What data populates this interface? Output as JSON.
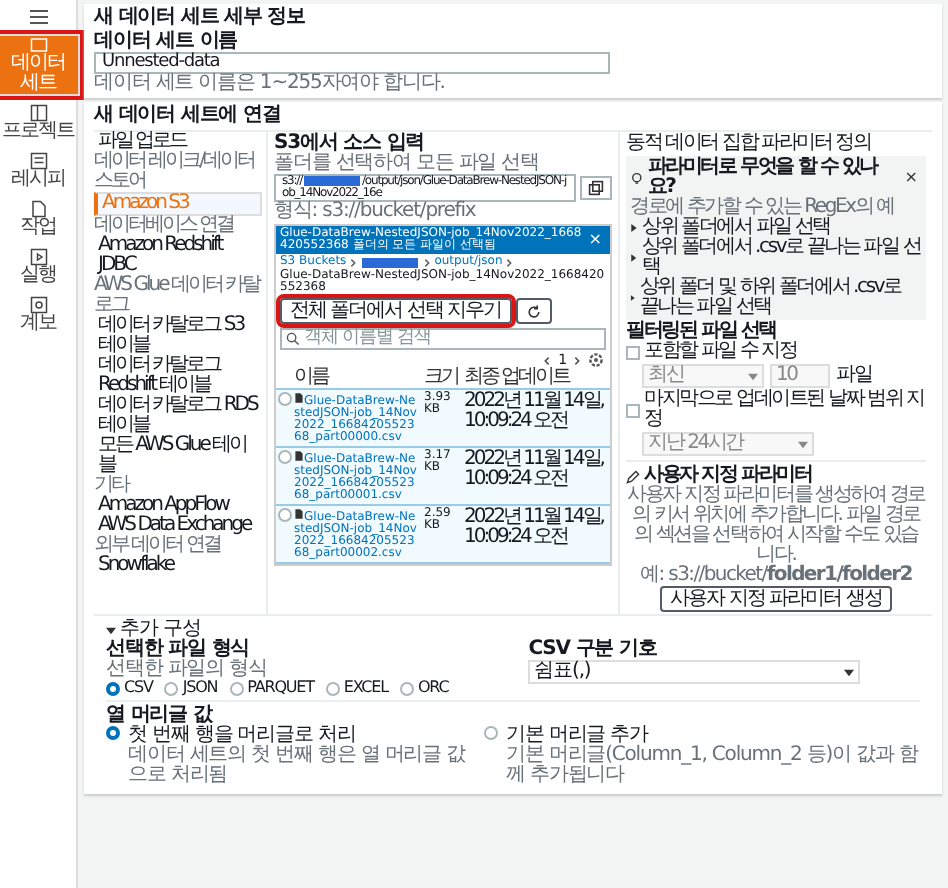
{
  "rail": {
    "items": [
      {
        "label": "데이터 세트",
        "selected": true,
        "highlighted": true
      },
      {
        "label": "프로젝트",
        "selected": false,
        "highlighted": false
      },
      {
        "label": "레시피",
        "selected": false,
        "highlighted": false
      },
      {
        "label": "작업",
        "selected": false,
        "highlighted": false
      },
      {
        "label": "실행",
        "selected": false,
        "highlighted": false
      },
      {
        "label": "계보",
        "selected": false,
        "highlighted": false
      }
    ]
  },
  "details": {
    "title": "새 데이터 세트 세부 정보",
    "name_label": "데이터 세트 이름",
    "name_value": "Unnested-data",
    "hint": "데이터 세트 이름은 1~255자여야 합니다."
  },
  "connect": {
    "title": "새 데이터 세트에 연결",
    "sources": [
      {
        "kind": "item",
        "label": "파일 업로드",
        "selected": false
      },
      {
        "kind": "group",
        "label": "데이터 레이크/데이터 스토어"
      },
      {
        "kind": "item",
        "label": "Amazon S3",
        "selected": true
      },
      {
        "kind": "group",
        "label": "데이터베이스 연결"
      },
      {
        "kind": "item",
        "label": "Amazon Redshift",
        "selected": false
      },
      {
        "kind": "item",
        "label": "JDBC",
        "selected": false
      },
      {
        "kind": "group",
        "label": "AWS Glue 데이터 카탈로그"
      },
      {
        "kind": "item",
        "label": "데이터 카탈로그 S3 테이블",
        "selected": false
      },
      {
        "kind": "item",
        "label": "데이터 카탈로그 Redshift 테이블",
        "selected": false
      },
      {
        "kind": "item",
        "label": "데이터 카탈로그 RDS 테이블",
        "selected": false
      },
      {
        "kind": "item",
        "label": "모든 AWS Glue 테이블",
        "selected": false
      },
      {
        "kind": "group",
        "label": "기타"
      },
      {
        "kind": "item",
        "label": "Amazon AppFlow",
        "selected": false
      },
      {
        "kind": "item",
        "label": "AWS Data Exchange",
        "selected": false
      },
      {
        "kind": "group",
        "label": "외부 데이터 연결"
      },
      {
        "kind": "item",
        "label": "Snowflake",
        "selected": false
      }
    ],
    "s3": {
      "title": "S3에서 소스 입력",
      "description": "폴더를 선택하여 모든 파일 선택",
      "path_prefix": "s3://",
      "path_suffix": "/output/json/Glue-DataBrew-NestedJSON-job_14Nov2022_16e",
      "format_hint": "형식: s3://bucket/prefix",
      "browser": {
        "header": "Glue-DataBrew-NestedJSON-job_14Nov2022_1668420552368 폴더의 모든 파일이 선택됨",
        "close": "×",
        "breadcrumb": [
          {
            "kind": "link",
            "text": "S3 Buckets"
          },
          {
            "kind": "redacted"
          },
          {
            "kind": "link",
            "text": "output/json"
          },
          {
            "kind": "text",
            "text": "Glue-DataBrew-NestedJSON-job_14Nov2022_1668420552368"
          }
        ],
        "clear_button": {
          "label": "전체 폴더에서 선택 지우기",
          "highlighted": true
        },
        "search_placeholder": "객체 이름별 검색",
        "page": "1",
        "columns": [
          "이름",
          "크기",
          "최종 업데이트"
        ],
        "rows": [
          {
            "name": "Glue-DataBrew-NestedJSON-job_14Nov2022_1668420552368_part00000.csv",
            "size": "3.93 KB",
            "updated": "2022년 11월 14일, 10:09:24 오전",
            "selected": false
          },
          {
            "name": "Glue-DataBrew-NestedJSON-job_14Nov2022_1668420552368_part00001.csv",
            "size": "3.17 KB",
            "updated": "2022년 11월 14일, 10:09:24 오전",
            "selected": false
          },
          {
            "name": "Glue-DataBrew-NestedJSON-job_14Nov2022_1668420552368_part00002.csv",
            "size": "2.59 KB",
            "updated": "2022년 11월 14일, 10:09:24 오전",
            "selected": false
          }
        ]
      }
    },
    "params": {
      "title": "동적 데이터 집합 파라미터 정의",
      "info": {
        "title": "파라미터로 무엇을 할 수 있나요?",
        "subtitle": "경로에 추가할 수 있는 RegEx의 예",
        "close": "×",
        "items": [
          "상위 폴더에서 파일 선택",
          "상위 폴더에서 .csv로 끝나는 파일 선택",
          "상위 폴더 및 하위 폴더에서 .csv로 끝나는 파일 선택"
        ]
      },
      "filter_title": "필터링된 파일 선택",
      "file_count": {
        "label": "포함할 파일 수 지정",
        "checked": false,
        "order": "최신",
        "count": "10",
        "unit": "파일"
      },
      "date_range": {
        "label": "마지막으로 업데이트된 날짜 범위 지정",
        "checked": false,
        "value": "지난 24시간"
      },
      "custom_title": "사용자 지정 파라미터",
      "custom_text": "사용자 지정 파라미터를 생성하여 경로의 키서 위치에 추가합니다. 파일 경로의 섹션을 선택하여 시작할 수도 있습니다.",
      "example": "예: s3://bucket/**folder1/folder2**",
      "custom_button": "사용자 지정 파라미터 생성"
    }
  },
  "additional": {
    "toggle": "추가 구성",
    "expanded": true,
    "format_label": "선택한 파일 형식",
    "format_hint": "선택한 파일의 형식",
    "formats": [
      {
        "label": "CSV",
        "selected": true
      },
      {
        "label": "JSON",
        "selected": false
      },
      {
        "label": "PARQUET",
        "selected": false
      },
      {
        "label": "EXCEL",
        "selected": false
      },
      {
        "label": "ORC",
        "selected": false
      }
    ],
    "delimiter_label": "CSV 구분 기호",
    "delimiter_value": "쉼표(,)",
    "header_label": "열 머리글 값",
    "header_options": [
      {
        "label": "첫 번째 행을 머리글로 처리",
        "description": "데이터 세트의 첫 번째 행은 열 머리글 값으로 처리됨",
        "selected": true
      },
      {
        "label": "기본 머리글 추가",
        "description": "기본 머리글(Column_1, Column_2 등)이 값과 함께 추가됩니다",
        "selected": false
      }
    ]
  }
}
